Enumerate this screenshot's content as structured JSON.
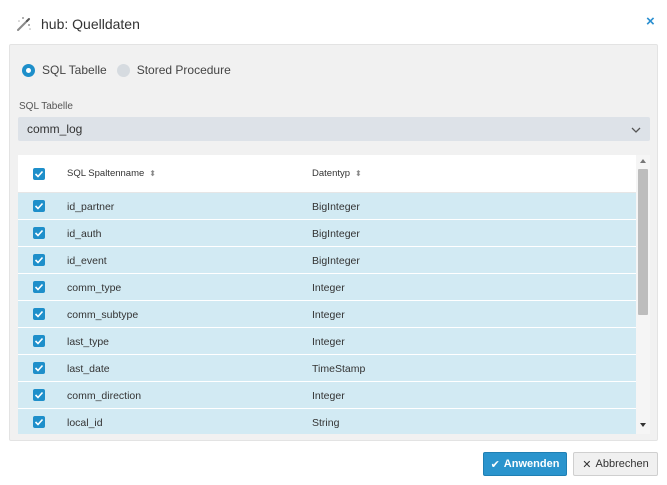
{
  "dialog": {
    "title": "hub: Quelldaten",
    "icon": "magic-wand-icon",
    "close_icon": "close-icon"
  },
  "source_type": {
    "options": [
      {
        "label": "SQL Tabelle",
        "selected": true
      },
      {
        "label": "Stored Procedure",
        "selected": false
      }
    ]
  },
  "sql_table": {
    "label": "SQL Tabelle",
    "value": "comm_log"
  },
  "grid": {
    "columns": [
      "SQL Spaltenname",
      "Datentyp"
    ],
    "header_checked": true,
    "rows": [
      {
        "name": "id_partner",
        "type": "BigInteger",
        "checked": true
      },
      {
        "name": "id_auth",
        "type": "BigInteger",
        "checked": true
      },
      {
        "name": "id_event",
        "type": "BigInteger",
        "checked": true
      },
      {
        "name": "comm_type",
        "type": "Integer",
        "checked": true
      },
      {
        "name": "comm_subtype",
        "type": "Integer",
        "checked": true
      },
      {
        "name": "last_type",
        "type": "Integer",
        "checked": true
      },
      {
        "name": "last_date",
        "type": "TimeStamp",
        "checked": true
      },
      {
        "name": "comm_direction",
        "type": "Integer",
        "checked": true
      },
      {
        "name": "local_id",
        "type": "String",
        "checked": true
      }
    ]
  },
  "buttons": {
    "apply": "Anwenden",
    "cancel": "Abbrechen"
  },
  "colors": {
    "accent": "#1e8fca",
    "row_selected": "#d2eaf3",
    "panel": "#f1f1f1"
  }
}
